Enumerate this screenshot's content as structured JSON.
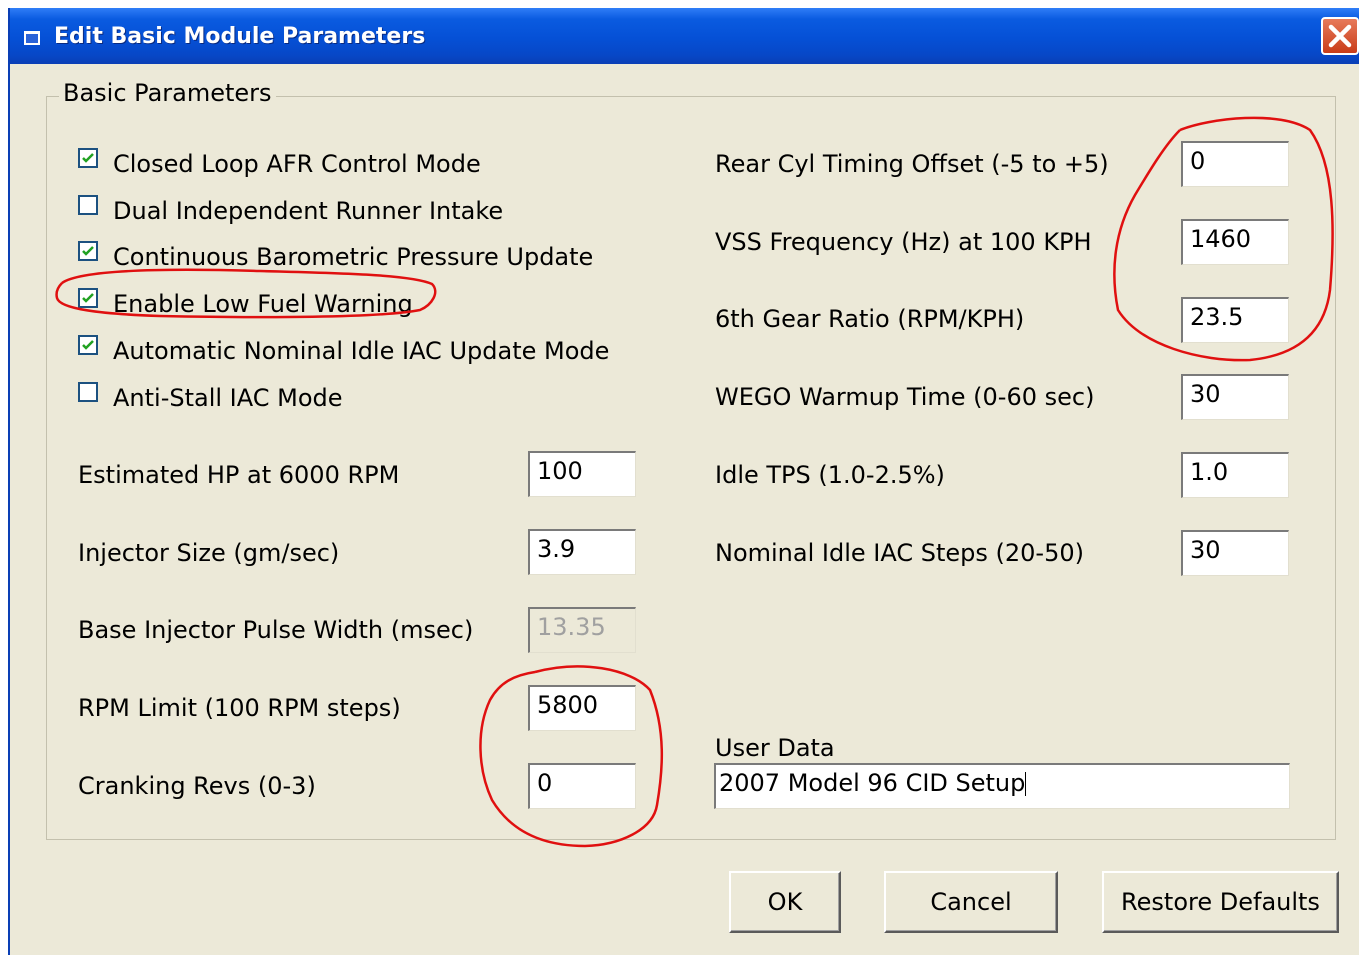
{
  "window": {
    "title": "Edit Basic Module Parameters"
  },
  "group": {
    "legend": "Basic Parameters"
  },
  "checkboxes": [
    {
      "label": "Closed Loop AFR Control Mode",
      "checked": true
    },
    {
      "label": "Dual Independent Runner Intake",
      "checked": false
    },
    {
      "label": "Continuous Barometric Pressure Update",
      "checked": true
    },
    {
      "label": "Enable Low Fuel Warning",
      "checked": true
    },
    {
      "label": "Automatic Nominal Idle IAC Update Mode",
      "checked": true
    },
    {
      "label": "Anti-Stall IAC Mode",
      "checked": false
    }
  ],
  "left_fields": [
    {
      "label": "Estimated HP at 6000 RPM",
      "value": "100",
      "disabled": false
    },
    {
      "label": "Injector Size (gm/sec)",
      "value": "3.9",
      "disabled": false
    },
    {
      "label": "Base Injector Pulse Width (msec)",
      "value": "13.35",
      "disabled": true
    },
    {
      "label": "RPM Limit (100 RPM steps)",
      "value": "5800",
      "disabled": false
    },
    {
      "label": "Cranking Revs (0-3)",
      "value": "0",
      "disabled": false
    }
  ],
  "right_fields": [
    {
      "label": "Rear Cyl Timing Offset (-5 to +5)",
      "value": "0"
    },
    {
      "label": "VSS Frequency (Hz)  at 100 KPH",
      "value": "1460"
    },
    {
      "label": "6th Gear Ratio (RPM/KPH)",
      "value": "23.5"
    },
    {
      "label": "WEGO Warmup Time (0-60 sec)",
      "value": "30"
    },
    {
      "label": "Idle TPS (1.0-2.5%)",
      "value": "1.0"
    },
    {
      "label": "Nominal Idle IAC Steps (20-50)",
      "value": "30"
    }
  ],
  "user_data": {
    "label": "User Data",
    "value": "2007 Model 96 CID Setup"
  },
  "buttons": {
    "ok": "OK",
    "cancel": "Cancel",
    "restore": "Restore Defaults"
  },
  "colors": {
    "titlebar": "#0550d6",
    "dialog_bg": "#ece9d8",
    "annotation": "#e01010"
  },
  "icons": {
    "app": "app-window-icon",
    "close": "close-x-icon",
    "check": "checkmark-icon"
  }
}
